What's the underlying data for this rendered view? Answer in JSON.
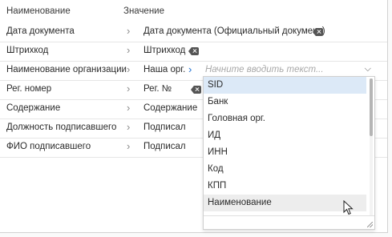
{
  "header": {
    "col_name": "Наименование",
    "col_value": "Значение"
  },
  "rows": [
    {
      "name": "Дата документа",
      "value": "Дата документа (Официальный документ)"
    },
    {
      "name": "Штрихкод",
      "value": "Штрихкод"
    },
    {
      "name": "Наименование организации",
      "value": "Наша орг."
    },
    {
      "name": "Рег. номер",
      "value": "Рег. №"
    },
    {
      "name": "Содержание",
      "value": "Содержание"
    },
    {
      "name": "Должность подписавшего",
      "value": "Подписал"
    },
    {
      "name": "ФИО подписавшего",
      "value": "Подписал"
    }
  ],
  "search_input": {
    "placeholder": "Начните вводить текст..."
  },
  "dropdown": {
    "selected_index": 0,
    "hover_index": 7,
    "options": [
      "SID",
      "Банк",
      "Головная орг.",
      "ИД",
      "ИНН",
      "Код",
      "КПП",
      "Наименование"
    ]
  },
  "colors": {
    "accent": "#1f6fd1",
    "selected_bg": "#dce9f7",
    "hover_bg": "#ededed"
  }
}
